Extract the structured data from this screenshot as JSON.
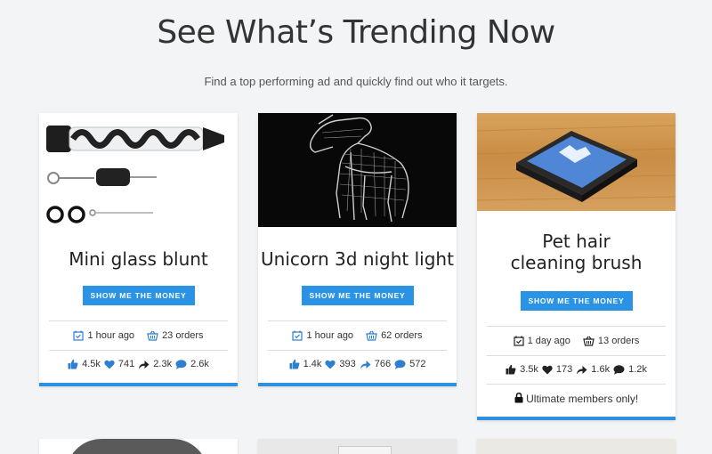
{
  "header": {
    "title": "See What’s Trending Now",
    "subtitle": "Find a top performing ad and quickly find out who it targets."
  },
  "cards": [
    {
      "title": "Mini glass blunt",
      "button_label": "SHOW ME THE MONEY",
      "time": "1 hour ago",
      "orders": "23 orders",
      "likes": "4.5k",
      "loves": "741",
      "shares": "2.3k",
      "comments": "2.6k"
    },
    {
      "title": "Unicorn 3d night light",
      "button_label": "SHOW ME THE MONEY",
      "time": "1 hour ago",
      "orders": "62 orders",
      "likes": "1.4k",
      "loves": "393",
      "shares": "766",
      "comments": "572"
    },
    {
      "title": "Pet hair cleaning brush",
      "button_label": "SHOW ME THE MONEY",
      "time": "1 day ago",
      "orders": "13 orders",
      "likes": "3.5k",
      "loves": "173",
      "shares": "1.6k",
      "comments": "1.2k",
      "locked_text": "Ultimate members only!"
    }
  ],
  "colors": {
    "accent": "#2b93e6",
    "stat_blue": "#2e7fd0",
    "stat_dark": "#222222"
  }
}
